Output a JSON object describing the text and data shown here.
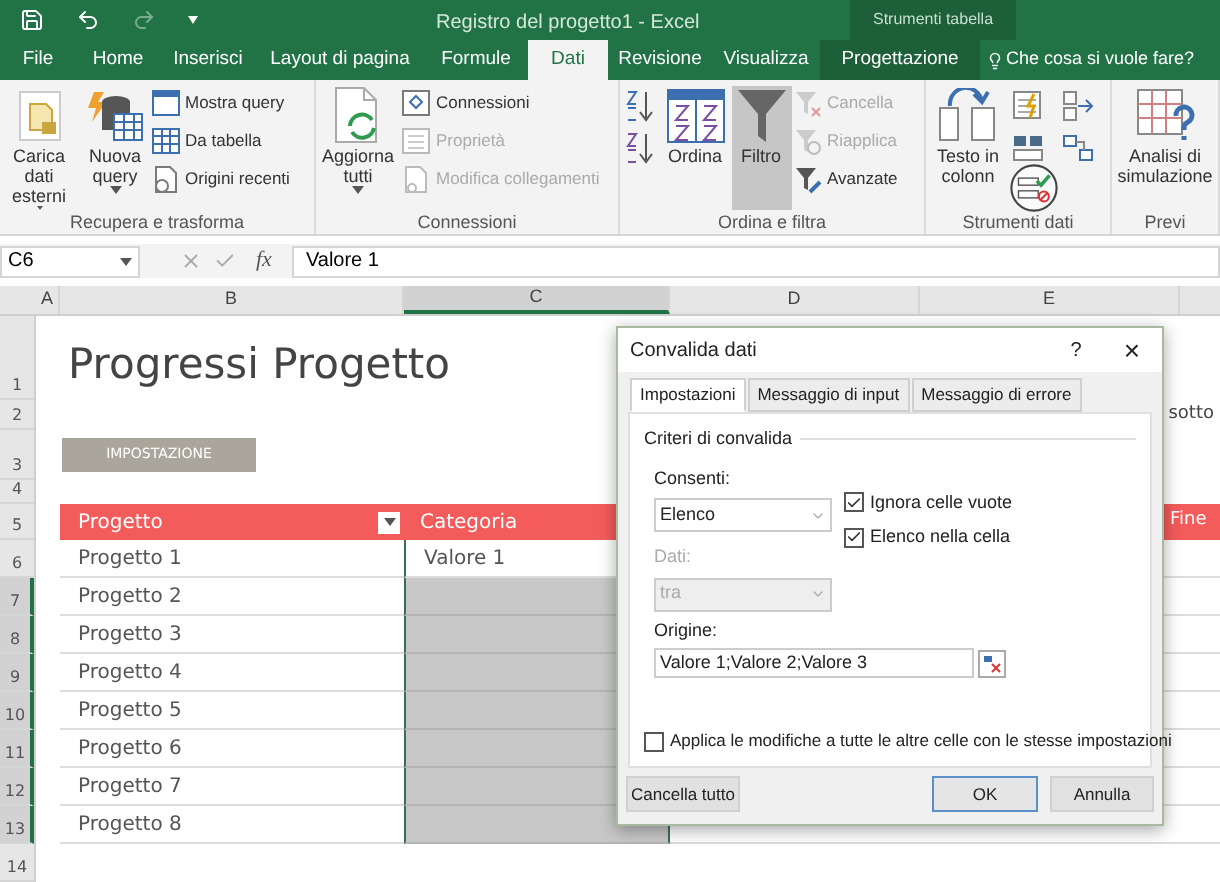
{
  "title_bar": {
    "title": "Registro del progetto1 - Excel",
    "contextual": "Strumenti tabella"
  },
  "ribbon_tabs": [
    {
      "label": "File",
      "selected": false,
      "kind": "plain"
    },
    {
      "label": "Home",
      "selected": false,
      "kind": "plain"
    },
    {
      "label": "Inserisci",
      "selected": false,
      "kind": "plain"
    },
    {
      "label": "Layout di pagina",
      "selected": false,
      "kind": "plain"
    },
    {
      "label": "Formule",
      "selected": false,
      "kind": "plain"
    },
    {
      "label": "Dati",
      "selected": true,
      "kind": "plain"
    },
    {
      "label": "Revisione",
      "selected": false,
      "kind": "plain"
    },
    {
      "label": "Visualizza",
      "selected": false,
      "kind": "plain"
    },
    {
      "label": "Progettazione",
      "selected": false,
      "kind": "contextual"
    },
    {
      "label": "Che cosa si vuole fare?",
      "selected": false,
      "kind": "tell_me"
    }
  ],
  "ribbon_groups": [
    {
      "label": "Recupera e trasforma",
      "columns": [
        [
          {
            "kind": "large",
            "label": "Carica dati esterni",
            "dropdown": true,
            "disabled": false
          }
        ],
        [
          {
            "kind": "large",
            "label": "Nuova query",
            "dropdown": true,
            "disabled": false
          }
        ],
        [
          {
            "kind": "small",
            "label": "Mostra query",
            "disabled": false
          },
          {
            "kind": "small",
            "label": "Da tabella",
            "disabled": false
          },
          {
            "kind": "small",
            "label": "Origini recenti",
            "disabled": false
          }
        ]
      ]
    },
    {
      "label": "Connessioni",
      "columns": [
        [
          {
            "kind": "large",
            "label": "Aggiorna tutti",
            "dropdown": true,
            "disabled": false
          }
        ],
        [
          {
            "kind": "small",
            "label": "Connessioni",
            "disabled": false
          },
          {
            "kind": "small",
            "label": "Proprietà",
            "disabled": true
          },
          {
            "kind": "small",
            "label": "Modifica collegamenti",
            "disabled": true
          }
        ]
      ]
    },
    {
      "label": "Ordina e filtra",
      "columns": [
        [
          {
            "kind": "icon",
            "disabled": false
          },
          {
            "kind": "icon",
            "disabled": false
          }
        ],
        [
          {
            "kind": "large",
            "label": "Ordina",
            "dropdown": false,
            "disabled": false
          }
        ],
        [
          {
            "kind": "large",
            "label": "Filtro",
            "dropdown": false,
            "disabled": false,
            "pressed": true
          }
        ],
        [
          {
            "kind": "small",
            "label": "Cancella",
            "disabled": true
          },
          {
            "kind": "small",
            "label": "Riapplica",
            "disabled": true
          },
          {
            "kind": "small",
            "label": "Avanzate",
            "disabled": false
          }
        ]
      ]
    },
    {
      "label": "Strumenti dati",
      "columns": [
        [
          {
            "kind": "large",
            "label": "Testo in colonn",
            "dropdown": false,
            "disabled": false
          }
        ],
        [
          {
            "kind": "icon",
            "disabled": false
          },
          {
            "kind": "icon",
            "disabled": false
          }
        ],
        [
          {
            "kind": "icon",
            "disabled": false
          },
          {
            "kind": "icon",
            "disabled": false
          }
        ]
      ]
    },
    {
      "label": "Previ",
      "columns": [
        [
          {
            "kind": "large",
            "label": "Analisi di simulazione",
            "dropdown": false,
            "disabled": false
          }
        ]
      ]
    }
  ],
  "formula_bar": {
    "name_box": "C6",
    "fx": "fx",
    "formula": "Valore 1"
  },
  "sheet": {
    "column_headers": [
      {
        "label": "A",
        "selected": false
      },
      {
        "label": "B",
        "selected": false
      },
      {
        "label": "C",
        "selected": true
      },
      {
        "label": "D",
        "selected": false
      },
      {
        "label": "E",
        "selected": false
      }
    ],
    "row_numbers": [
      "1",
      "2",
      "3",
      "4",
      "5",
      "6",
      "7",
      "8",
      "9",
      "10",
      "11",
      "12",
      "13",
      "14"
    ],
    "title": "Progressi Progetto",
    "note": "sotto",
    "setup_button": "IMPOSTAZIONE",
    "table_headers": [
      "Progetto",
      "Categoria",
      "Fine"
    ],
    "rows": [
      {
        "project": "Progetto 1",
        "category": "Valore 1",
        "selected": false
      },
      {
        "project": "Progetto 2",
        "selected": true
      },
      {
        "project": "Progetto 3",
        "selected": true
      },
      {
        "project": "Progetto 4",
        "selected": true
      },
      {
        "project": "Progetto 5",
        "selected": true
      },
      {
        "project": "Progetto 6",
        "selected": true
      },
      {
        "project": "Progetto 7",
        "selected": true
      },
      {
        "project": "Progetto 8",
        "selected": true
      }
    ]
  },
  "dialog": {
    "title": "Convalida dati",
    "help": "?",
    "close": "×",
    "tabs": [
      {
        "label": "Impostazioni",
        "selected": true
      },
      {
        "label": "Messaggio di input",
        "selected": false
      },
      {
        "label": "Messaggio di errore",
        "selected": false
      }
    ],
    "section": "Criteri di convalida",
    "allow": {
      "label": "Consenti:",
      "value": "Elenco",
      "disabled": false
    },
    "data": {
      "label": "Dati:",
      "value": "tra",
      "disabled": true
    },
    "checkboxes": [
      {
        "label": "Ignora celle vuote",
        "checked": true
      },
      {
        "label": "Elenco nella cella",
        "checked": true
      }
    ],
    "source": {
      "label": "Origine:",
      "value": "Valore 1;Valore 2;Valore 3"
    },
    "apply_all": {
      "label": "Applica le modifiche a tutte le altre celle con le stesse impostazioni",
      "checked": false
    },
    "buttons": [
      {
        "label": "Cancella tutto",
        "kind": "left"
      },
      {
        "label": "OK",
        "kind": "default"
      },
      {
        "label": "Annulla",
        "kind": "normal"
      }
    ]
  }
}
